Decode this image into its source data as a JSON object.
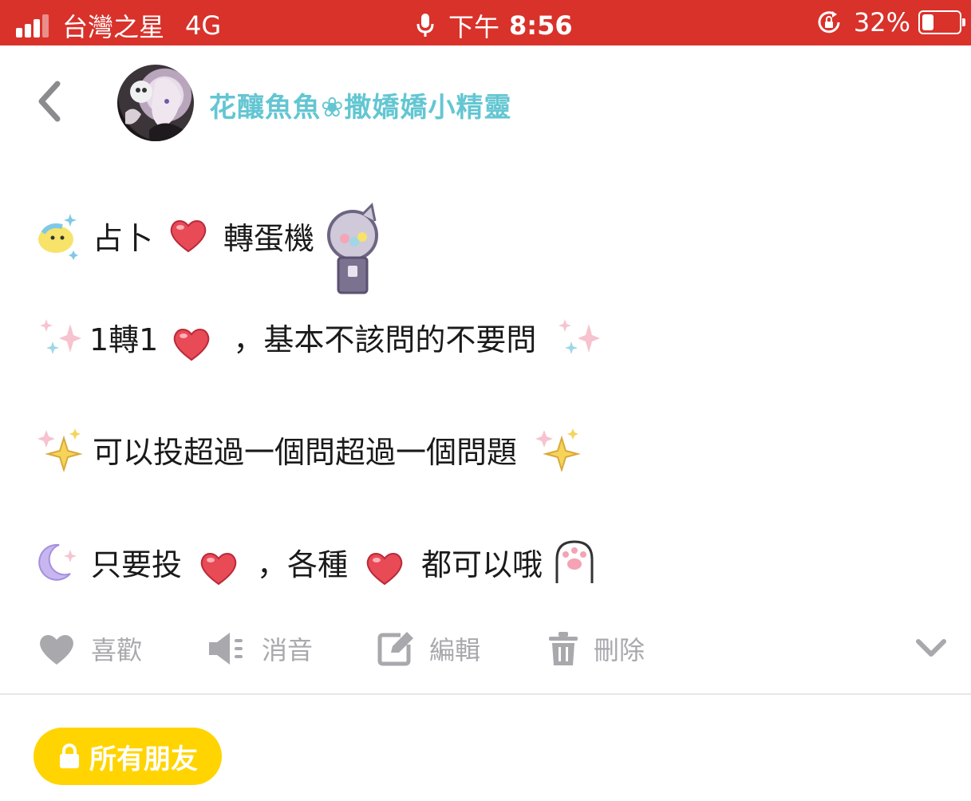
{
  "status_bar": {
    "carrier": "台灣之星",
    "network": "4G",
    "time_prefix": "下午",
    "time": "8:56",
    "battery_percent": "32%",
    "battery_level": 0.32,
    "background_color": "#d8322b"
  },
  "header": {
    "user_name": "花釀魚魚❀撒嬌嬌小精靈",
    "name_color": "#63c6d2"
  },
  "post": {
    "line1": {
      "text_a": "占卜",
      "text_b": "轉蛋機"
    },
    "line2": {
      "text_a": "1轉1",
      "text_b": "，基本不該問的不要問"
    },
    "line3": {
      "text_a": "可以投超過一個問超過一個問題"
    },
    "line4": {
      "text_a": "只要投",
      "text_b": "，各種",
      "text_c": "都可以哦"
    }
  },
  "actions": {
    "like": "喜歡",
    "mute": "消音",
    "edit": "編輯",
    "delete": "刪除"
  },
  "privacy": {
    "label": "所有朋友",
    "color": "#ffd400"
  },
  "icons": [
    "signal-icon",
    "mic-icon",
    "rotation-lock-icon",
    "battery-icon",
    "back-chevron-icon",
    "bird-sparkle-icon",
    "heart-icon",
    "gacha-machine-icon",
    "sparkle-icon",
    "gold-sparkle-icon",
    "moon-star-icon",
    "paw-icon",
    "thumb-heart-icon",
    "speaker-mute-icon",
    "edit-icon",
    "trash-icon",
    "chevron-down-icon",
    "lock-icon"
  ]
}
